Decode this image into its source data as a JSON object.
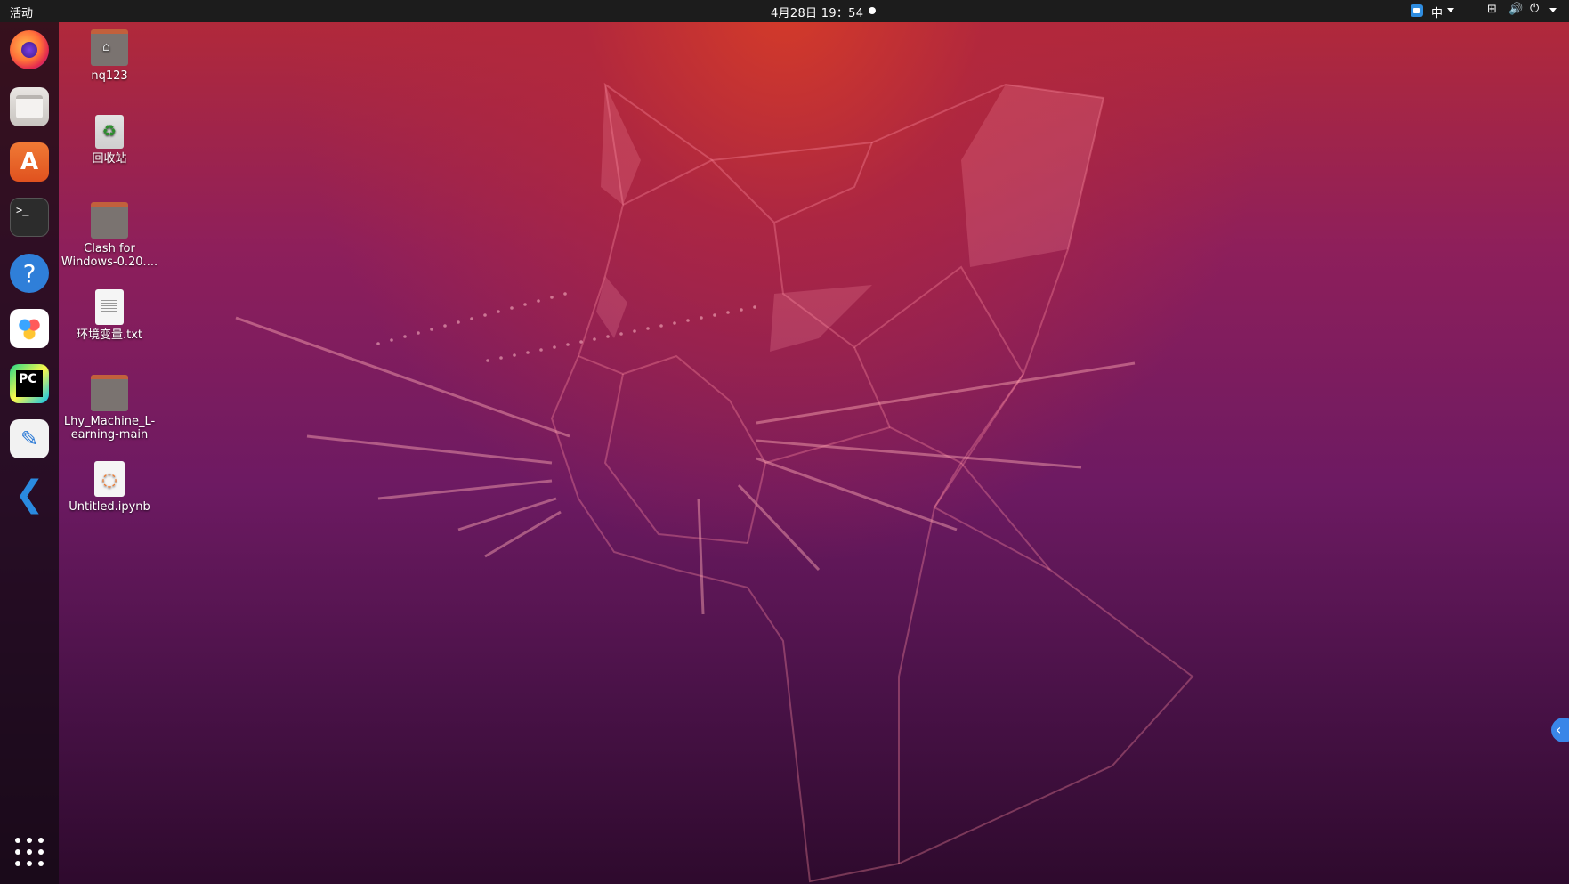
{
  "topbar": {
    "activities_label": "活动",
    "clock": "4月28日  19：54",
    "ime_label": "中"
  },
  "dock": {
    "items": [
      {
        "name": "Firefox",
        "icon": "firefox-icon"
      },
      {
        "name": "Files",
        "icon": "files-icon"
      },
      {
        "name": "Ubuntu Software",
        "icon": "software-center-icon",
        "glyph": "A"
      },
      {
        "name": "Terminal",
        "icon": "terminal-icon",
        "glyph": ">_"
      },
      {
        "name": "Help",
        "icon": "help-icon",
        "glyph": "?"
      },
      {
        "name": "Baidu Netdisk",
        "icon": "baidu-netdisk-icon"
      },
      {
        "name": "PyCharm",
        "icon": "pycharm-icon",
        "glyph": "PC"
      },
      {
        "name": "Text Editor",
        "icon": "text-editor-icon",
        "glyph": "✎"
      },
      {
        "name": "Visual Studio Code",
        "icon": "vscode-icon",
        "glyph": "❮"
      }
    ],
    "show_apps_icon": "app-grid-icon"
  },
  "desktop": {
    "icons": [
      {
        "label": "nq123",
        "type": "home-folder"
      },
      {
        "label": "回收站",
        "type": "trash"
      },
      {
        "label": "Clash for Windows-0.20....",
        "type": "folder"
      },
      {
        "label": "环境变量.txt",
        "type": "text-file"
      },
      {
        "label": "Lhy_Machine_L-earning-main",
        "type": "folder"
      },
      {
        "label": "Untitled.ipynb",
        "type": "notebook-file"
      }
    ]
  },
  "colors": {
    "topbar": "#1c1c1c",
    "wallpaper_top": "#b42a37",
    "wallpaper_bottom": "#2e0a2d",
    "accent_blue": "#3a86e8"
  }
}
